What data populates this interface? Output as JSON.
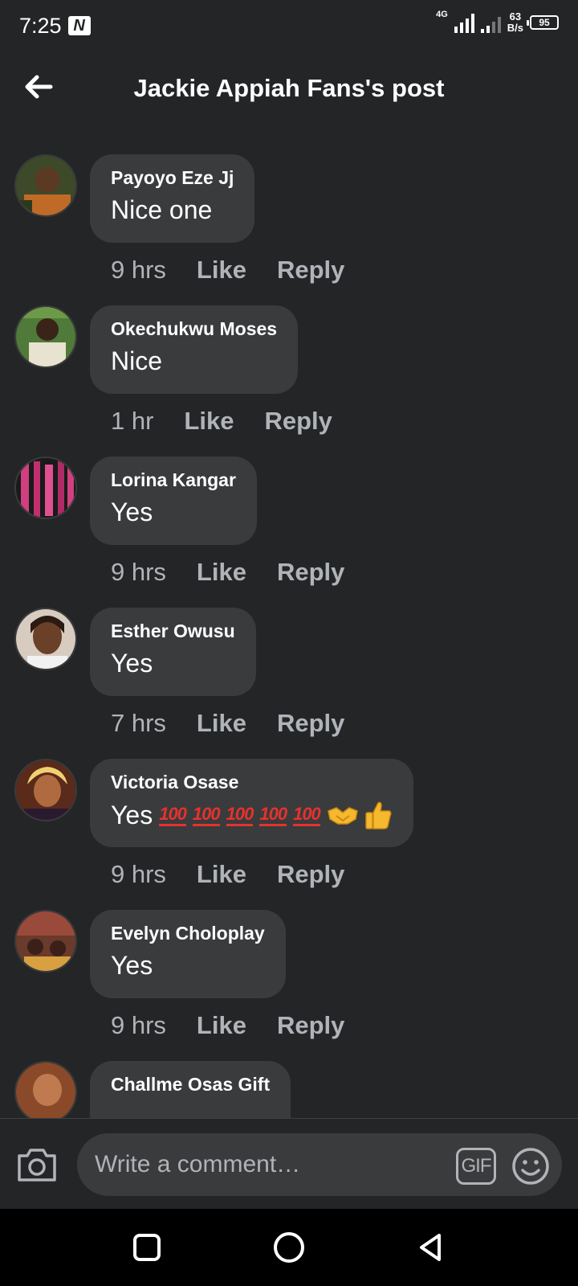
{
  "status_bar": {
    "time": "7:25",
    "network_type": "4G",
    "net_speed_value": "63",
    "net_speed_unit": "B/s",
    "battery_level": "95"
  },
  "header": {
    "title": "Jackie Appiah Fans's post"
  },
  "comments": [
    {
      "author": "Payoyo Eze Jj",
      "text": "Nice one",
      "time": "9 hrs",
      "like": "Like",
      "reply": "Reply",
      "avatar_color": "#8a5a2a"
    },
    {
      "author": "Okechukwu Moses",
      "text": "Nice",
      "time": "1 hr",
      "like": "Like",
      "reply": "Reply",
      "avatar_color": "#4f7a3a"
    },
    {
      "author": "Lorina Kangar",
      "text": "Yes",
      "time": "9 hrs",
      "like": "Like",
      "reply": "Reply",
      "avatar_color": "#b0306a"
    },
    {
      "author": "Esther Owusu",
      "text": "Yes",
      "time": "7 hrs",
      "like": "Like",
      "reply": "Reply",
      "avatar_color": "#c8a890"
    },
    {
      "author": "Victoria Osase",
      "text": "Yes",
      "time": "9 hrs",
      "like": "Like",
      "reply": "Reply",
      "avatar_color": "#a0522d",
      "emojis": [
        "hundred-points",
        "hundred-points",
        "hundred-points",
        "hundred-points",
        "hundred-points",
        "handshake",
        "thumbs-up"
      ]
    },
    {
      "author": "Evelyn Choloplay",
      "text": "Yes",
      "time": "9 hrs",
      "like": "Like",
      "reply": "Reply",
      "avatar_color": "#8c5a4a"
    },
    {
      "author": "Challme Osas Gift",
      "avatar_color": "#b07040"
    }
  ],
  "composer": {
    "placeholder": "Write a comment…",
    "gif_label": "GIF"
  },
  "icons": {
    "back": "back-arrow-icon",
    "camera": "camera-icon",
    "gif": "gif-icon",
    "emoji": "smiley-icon",
    "nav_recents": "square-icon",
    "nav_home": "circle-icon",
    "nav_back": "triangle-back-icon"
  },
  "colors": {
    "background": "#242527",
    "bubble": "#3a3b3c",
    "secondary_text": "#b0b3b8"
  }
}
